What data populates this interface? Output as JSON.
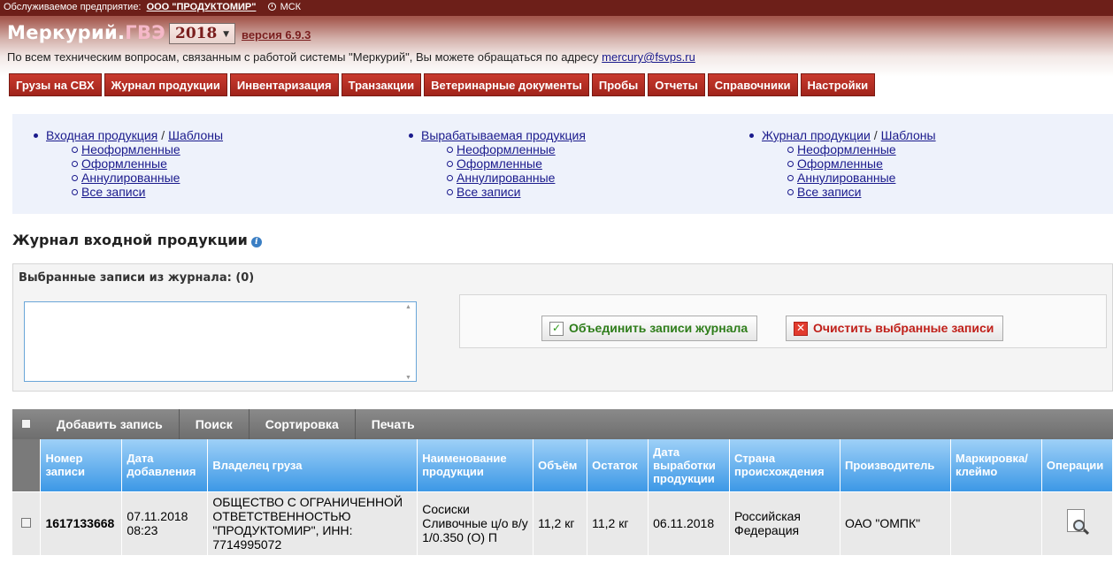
{
  "topbar": {
    "enterprise_label": "Обслуживаемое предприятие:",
    "enterprise_name": "ООО \"ПРОДУКТОМИР\"",
    "timezone": "МСК"
  },
  "header": {
    "logo_main": "Меркурий.",
    "logo_suffix": "ГВЭ",
    "year": "2018",
    "version": "версия 6.9.3",
    "support_text": "По всем техническим вопросам, связанным с работой системы \"Меркурий\", Вы можете обращаться по адресу",
    "support_email": "mercury@fsvps.ru"
  },
  "nav": {
    "items": [
      {
        "label": "Грузы на СВХ"
      },
      {
        "label": "Журнал продукции"
      },
      {
        "label": "Инвентаризация"
      },
      {
        "label": "Транзакции"
      },
      {
        "label": "Ветеринарные документы"
      },
      {
        "label": "Пробы"
      },
      {
        "label": "Отчеты"
      },
      {
        "label": "Справочники"
      },
      {
        "label": "Настройки"
      }
    ]
  },
  "submenu": {
    "incoming": {
      "title": "Входная продукция",
      "templates": "Шаблоны",
      "items": [
        "Неоформленные",
        "Оформленные",
        "Аннулированные",
        "Все записи"
      ]
    },
    "produced": {
      "title": "Вырабатываемая продукция",
      "items": [
        "Неоформленные",
        "Оформленные",
        "Аннулированные",
        "Все записи"
      ]
    },
    "journal": {
      "title": "Журнал продукции",
      "templates": "Шаблоны",
      "items": [
        "Неоформленные",
        "Оформленные",
        "Аннулированные",
        "Все записи"
      ]
    }
  },
  "page": {
    "title": "Журнал входной продукции",
    "info_icon": "i"
  },
  "selected": {
    "label": "Выбранные записи из журнала: (0)",
    "textarea_value": "",
    "merge_label": "Объединить записи журнала",
    "clear_label": "Очистить выбранные записи"
  },
  "toolbar": {
    "add": "Добавить запись",
    "search": "Поиск",
    "sort": "Сортировка",
    "print": "Печать"
  },
  "grid": {
    "headers": {
      "number": "Номер записи",
      "added": "Дата добавления",
      "owner": "Владелец груза",
      "product": "Наименование продукции",
      "volume": "Объём",
      "remainder": "Остаток",
      "production_date": "Дата выработки продукции",
      "country": "Страна происхождения",
      "producer": "Производитель",
      "marking": "Маркировка/ клеймо",
      "ops": "Операции"
    },
    "rows": [
      {
        "number": "1617133668",
        "added": "07.11.2018 08:23",
        "owner": "ОБЩЕСТВО С ОГРАНИЧЕННОЙ ОТВЕТСТВЕННОСТЬЮ \"ПРОДУКТОМИР\", ИНН: 7714995072",
        "product": "Сосиски Сливочные ц/о в/у 1/0.350 (О) П",
        "volume": "11,2 кг",
        "remainder": "11,2 кг",
        "production_date": "06.11.2018",
        "country": "Российская Федерация",
        "producer": "ОАО \"ОМПК\"",
        "marking": ""
      }
    ]
  },
  "colors": {
    "header_dark": "#6d1f19",
    "nav_red": "#a0241b",
    "grid_header_blue": "#3c98e6",
    "merge_green": "#2e7d1a",
    "clear_red": "#c0201a"
  }
}
